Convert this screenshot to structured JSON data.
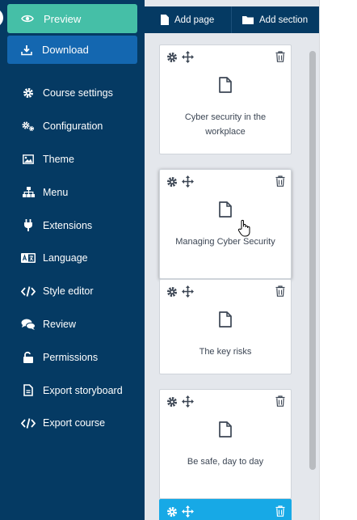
{
  "sidebar": {
    "preview_label": "Preview",
    "download_label": "Download",
    "items": [
      {
        "label": "Course settings",
        "icon": "gear-icon"
      },
      {
        "label": "Configuration",
        "icon": "gears-icon"
      },
      {
        "label": "Theme",
        "icon": "image-icon"
      },
      {
        "label": "Menu",
        "icon": "sitemap-icon"
      },
      {
        "label": "Extensions",
        "icon": "plug-icon"
      },
      {
        "label": "Language",
        "icon": "language-icon"
      },
      {
        "label": "Style editor",
        "icon": "code-icon"
      },
      {
        "label": "Review",
        "icon": "comments-icon"
      },
      {
        "label": "Permissions",
        "icon": "unlock-icon"
      },
      {
        "label": "Export storyboard",
        "icon": "file-icon"
      },
      {
        "label": "Export course",
        "icon": "code-icon"
      }
    ]
  },
  "toolbar": {
    "add_page_label": "Add page",
    "add_section_label": "Add section"
  },
  "pages": [
    {
      "title": "Cyber security in the workplace"
    },
    {
      "title": "Managing Cyber Security"
    },
    {
      "title": "The key risks"
    },
    {
      "title": "Be safe, day to day"
    }
  ],
  "colors": {
    "sidebar_bg": "#053a63",
    "preview_bg": "#45bfa7",
    "download_bg": "#1467b0",
    "active_card": "#17a9e6"
  }
}
